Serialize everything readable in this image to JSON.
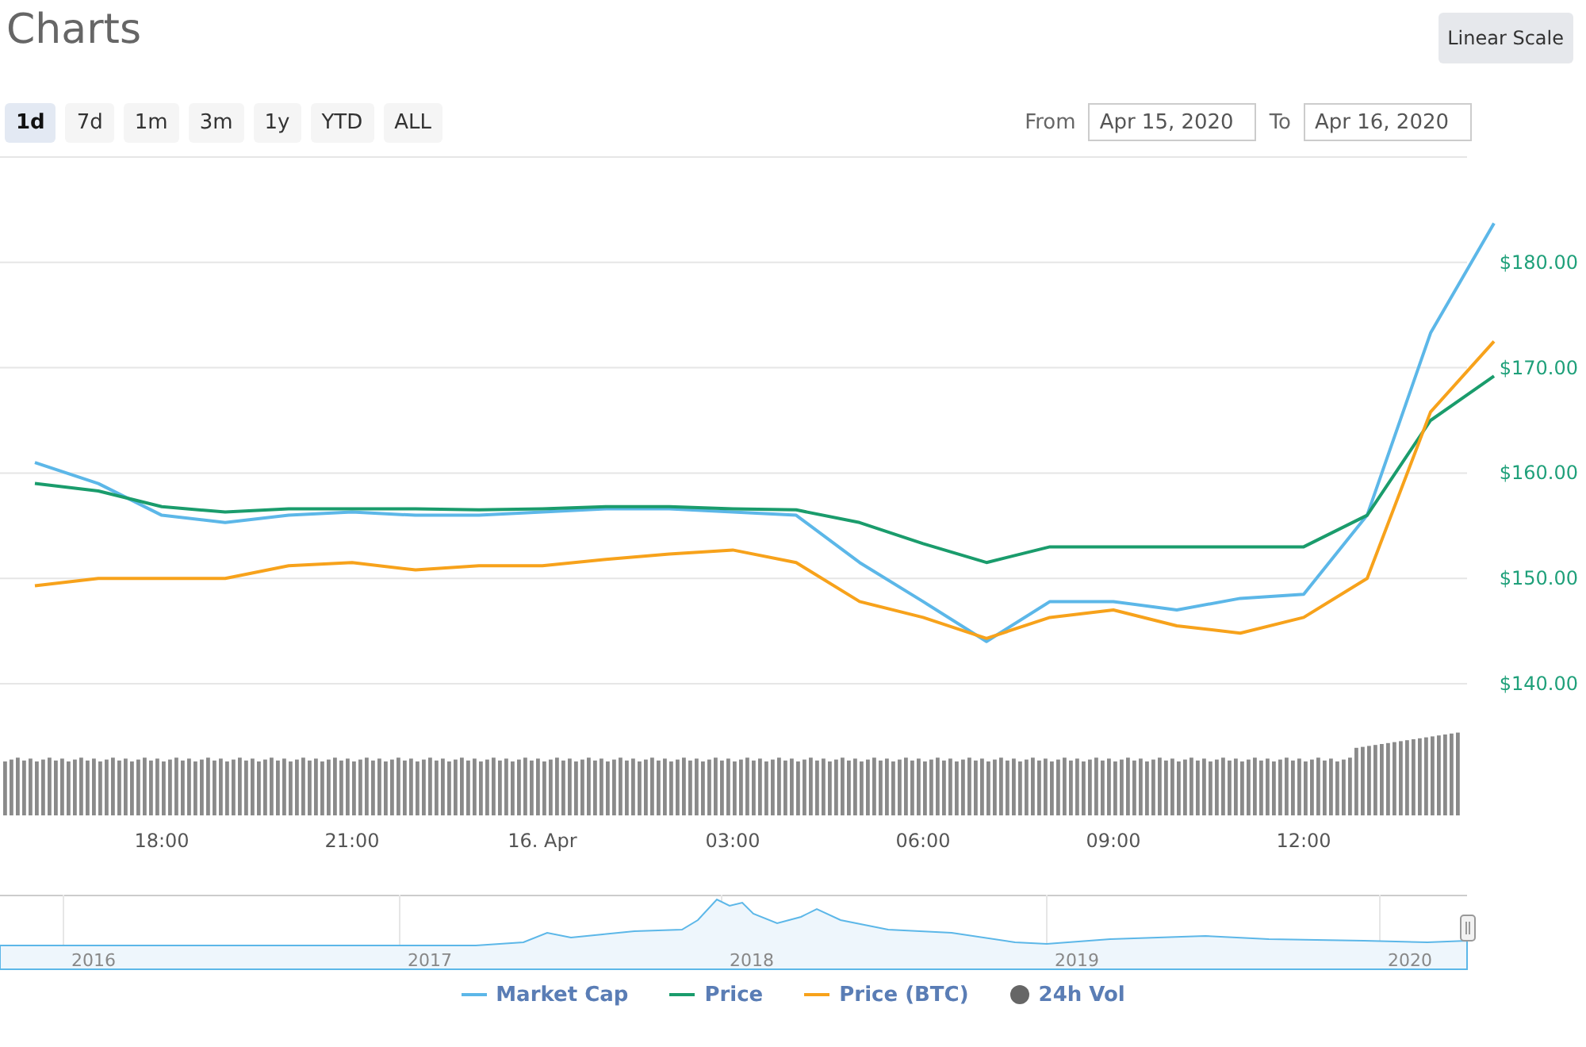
{
  "header": {
    "title": "Charts",
    "scale_button": "Linear Scale"
  },
  "ranges": [
    {
      "label": "1d",
      "selected": true
    },
    {
      "label": "7d",
      "selected": false
    },
    {
      "label": "1m",
      "selected": false
    },
    {
      "label": "3m",
      "selected": false
    },
    {
      "label": "1y",
      "selected": false
    },
    {
      "label": "YTD",
      "selected": false
    },
    {
      "label": "ALL",
      "selected": false
    }
  ],
  "date_range": {
    "from_label": "From",
    "from": "Apr 15, 2020",
    "to_label": "To",
    "to": "Apr 16, 2020"
  },
  "chart": {
    "chart_data": {
      "type": "line",
      "grid": true,
      "categories": [
        null,
        null,
        "18:00",
        null,
        null,
        "21:00",
        null,
        null,
        "16. Apr",
        null,
        null,
        "03:00",
        null,
        null,
        "06:00",
        null,
        null,
        "09:00",
        null,
        null,
        "12:00",
        null,
        null,
        null
      ],
      "ylim": [
        140,
        190
      ],
      "yticks": [
        {
          "value": 140,
          "label": "$140.00"
        },
        {
          "value": 150,
          "label": "$150.00"
        },
        {
          "value": 160,
          "label": "$160.00"
        },
        {
          "value": 170,
          "label": "$170.00"
        },
        {
          "value": 180,
          "label": "$180.00"
        }
      ],
      "series": [
        {
          "name": "Market Cap",
          "color": "#5cb7e8",
          "values": [
            161.0,
            159.0,
            156.0,
            155.3,
            156.0,
            156.3,
            156.0,
            156.0,
            156.3,
            156.6,
            156.6,
            156.3,
            156.0,
            151.5,
            147.8,
            144.0,
            147.8,
            147.8,
            147.0,
            148.1,
            148.5,
            156.0,
            173.3,
            183.7
          ]
        },
        {
          "name": "Price",
          "color": "#1a9c6c",
          "values": [
            159.0,
            158.3,
            156.8,
            156.3,
            156.6,
            156.6,
            156.6,
            156.5,
            156.6,
            156.8,
            156.8,
            156.6,
            156.5,
            155.3,
            153.3,
            151.5,
            153.0,
            153.0,
            153.0,
            153.0,
            153.0,
            156.0,
            165.0,
            169.2
          ]
        },
        {
          "name": "Price (BTC)",
          "color": "#f7a21b",
          "values": [
            149.3,
            150.0,
            150.0,
            150.0,
            151.2,
            151.5,
            150.8,
            151.2,
            151.2,
            151.8,
            152.3,
            152.7,
            151.5,
            147.8,
            146.3,
            144.3,
            146.3,
            147.0,
            145.5,
            144.8,
            146.3,
            150.0,
            165.8,
            172.5
          ]
        }
      ]
    }
  },
  "navigator": {
    "years": [
      "2016",
      "2017",
      "2018",
      "2019",
      "2020"
    ]
  },
  "volume_legend": {
    "label": "24h Vol"
  }
}
